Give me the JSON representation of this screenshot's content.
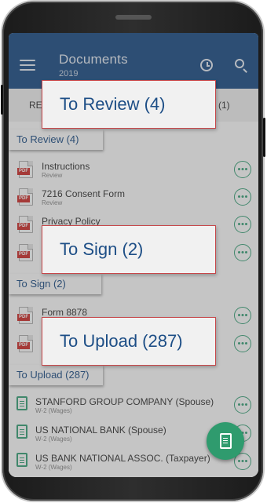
{
  "header": {
    "title": "Documents",
    "subtitle": "2019"
  },
  "tabs": [
    {
      "label": "RE"
    },
    {
      "label": "(1)"
    }
  ],
  "sections": {
    "review": {
      "label": "To Review (4)",
      "callout": "To Review (4)"
    },
    "sign": {
      "label": "To Sign (2)",
      "callout": "To Sign (2)"
    },
    "upload": {
      "label": "To Upload (287)",
      "callout": "To Upload (287)"
    }
  },
  "review_items": [
    {
      "name": "Instructions",
      "status": "Review"
    },
    {
      "name": "7216 Consent Form",
      "status": "Review"
    },
    {
      "name": "Privacy Policy",
      "status": ""
    },
    {
      "name": "",
      "status": ""
    }
  ],
  "sign_items": [
    {
      "name": "Form 8878",
      "status": ""
    },
    {
      "name": "",
      "status": ""
    }
  ],
  "upload_items": [
    {
      "name": "STANFORD GROUP COMPANY (Spouse)",
      "type": "W-2 (Wages)"
    },
    {
      "name": "US NATIONAL BANK (Spouse)",
      "type": "W-2 (Wages)"
    },
    {
      "name": "US BANK NATIONAL ASSOC. (Taxpayer)",
      "type": "W-2 (Wages)"
    }
  ],
  "icons": {
    "file_badge": "PDF"
  },
  "colors": {
    "primary": "#1d4e86",
    "accent": "#3aa37a",
    "fab": "#2f9b6e",
    "callout_border": "#c7474a"
  }
}
